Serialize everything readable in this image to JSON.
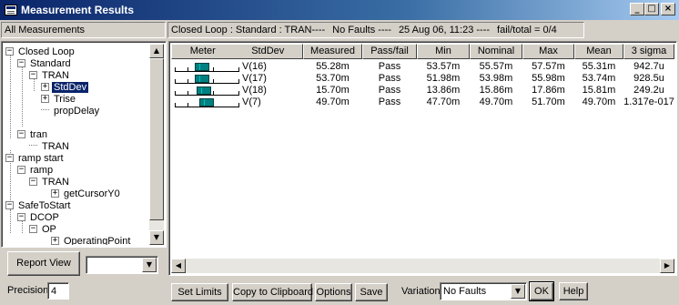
{
  "window": {
    "title": "Measurement Results",
    "buttons": {
      "minimize": "_",
      "maximize": "□",
      "close": "×"
    }
  },
  "left_header": "All Measurements",
  "status": {
    "path": "Closed Loop : Standard : TRAN----",
    "faults": "No Faults ----",
    "timestamp": "25 Aug 06, 11:23 ----",
    "fail_total": "fail/total = 0/4"
  },
  "tree": [
    {
      "label": "Closed Loop",
      "toggle": "−"
    },
    {
      "label": "Standard",
      "toggle": "−"
    },
    {
      "label": "TRAN",
      "toggle": "−"
    },
    {
      "label": "StdDev",
      "toggle": "+",
      "selected": true
    },
    {
      "label": "Trise",
      "toggle": "+"
    },
    {
      "label": "propDelay",
      "toggle": ""
    },
    {
      "label": "tran",
      "toggle": "−"
    },
    {
      "label": "TRAN",
      "toggle": ""
    },
    {
      "label": "ramp start",
      "toggle": "−"
    },
    {
      "label": "ramp",
      "toggle": "−"
    },
    {
      "label": "TRAN",
      "toggle": "−"
    },
    {
      "label": "getCursorY0",
      "toggle": "+"
    },
    {
      "label": "SafeToStart",
      "toggle": "−"
    },
    {
      "label": "DCOP",
      "toggle": "−"
    },
    {
      "label": "OP",
      "toggle": "−"
    },
    {
      "label": "OperatingPoint",
      "toggle": "+"
    }
  ],
  "table": {
    "headers": {
      "meter": "Meter",
      "name": "StdDev",
      "measured": "Measured",
      "passfail": "Pass/fail",
      "min": "Min",
      "nominal": "Nominal",
      "max": "Max",
      "mean": "Mean",
      "sigma": "3 sigma"
    },
    "rows": [
      {
        "name": "V(16)",
        "measured": "55.28m",
        "passfail": "Pass",
        "min": "53.57m",
        "nominal": "55.57m",
        "max": "57.57m",
        "mean": "55.31m",
        "sigma": "942.7u"
      },
      {
        "name": "V(17)",
        "measured": "53.70m",
        "passfail": "Pass",
        "min": "51.98m",
        "nominal": "53.98m",
        "max": "55.98m",
        "mean": "53.74m",
        "sigma": "928.5u"
      },
      {
        "name": "V(18)",
        "measured": "15.70m",
        "passfail": "Pass",
        "min": "13.86m",
        "nominal": "15.86m",
        "max": "17.86m",
        "mean": "15.81m",
        "sigma": "249.2u"
      },
      {
        "name": "V(7)",
        "measured": "49.70m",
        "passfail": "Pass",
        "min": "47.70m",
        "nominal": "49.70m",
        "max": "51.70m",
        "mean": "49.70m",
        "sigma": "1.317e-017"
      }
    ]
  },
  "bottom": {
    "report_view": "Report View",
    "report_combo_value": "",
    "precision_label": "Precision",
    "precision_value": "4",
    "set_limits": "Set Limits",
    "copy_clipboard": "Copy to Clipboard",
    "options": "Options",
    "save": "Save",
    "variation_label": "Variation",
    "variation_value": "No Faults",
    "ok": "OK",
    "help": "Help"
  },
  "colors": {
    "meter_fill": "#008080",
    "title_bar": "#0a246a",
    "selection": "#0a246a"
  }
}
